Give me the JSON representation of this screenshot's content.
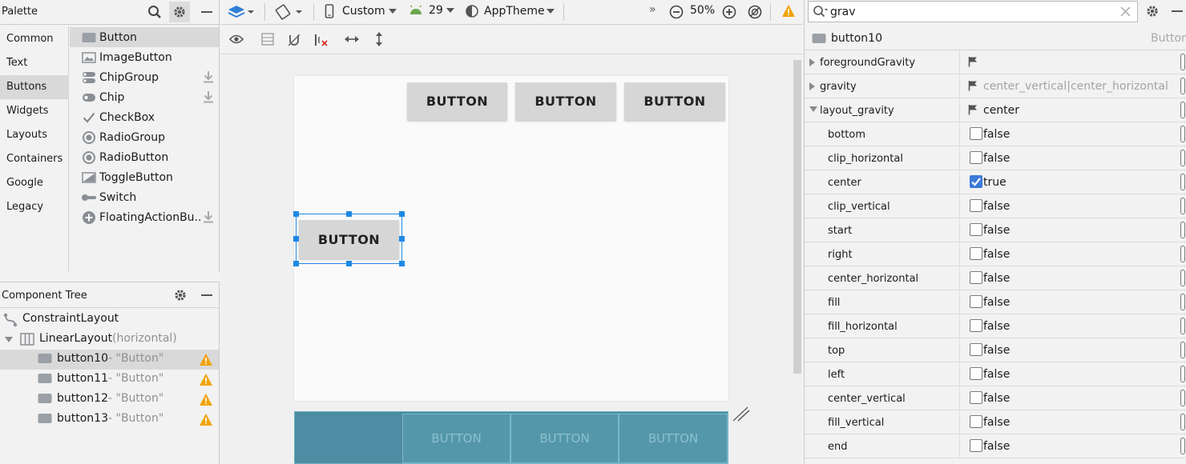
{
  "palette": {
    "title": "Palette",
    "categories": [
      "Common",
      "Text",
      "Buttons",
      "Widgets",
      "Layouts",
      "Containers",
      "Google",
      "Legacy"
    ],
    "selected_category": "Buttons",
    "widgets": [
      {
        "label": "Button",
        "icon": "button-icon",
        "download": false
      },
      {
        "label": "ImageButton",
        "icon": "image-icon",
        "download": false
      },
      {
        "label": "ChipGroup",
        "icon": "chipgroup-icon",
        "download": true
      },
      {
        "label": "Chip",
        "icon": "chip-icon",
        "download": true
      },
      {
        "label": "CheckBox",
        "icon": "checkmark-icon",
        "download": false
      },
      {
        "label": "RadioGroup",
        "icon": "radio-icon",
        "download": false
      },
      {
        "label": "RadioButton",
        "icon": "radio-icon",
        "download": false
      },
      {
        "label": "ToggleButton",
        "icon": "toggle-icon",
        "download": false
      },
      {
        "label": "Switch",
        "icon": "switch-icon",
        "download": false
      },
      {
        "label": "FloatingActionBu...",
        "icon": "fab-icon",
        "download": true
      }
    ]
  },
  "component_tree": {
    "title": "Component Tree",
    "items": [
      {
        "label": "ConstraintLayout",
        "sub": "",
        "level": 0,
        "expanded": null,
        "warn": false,
        "icon": "constraint-layout-icon"
      },
      {
        "label": "LinearLayout",
        "sub": "(horizontal)",
        "level": 0,
        "expanded": true,
        "warn": false,
        "icon": "linear-layout-icon"
      },
      {
        "label": "button10",
        "sub": "- \"Button\"",
        "level": 1,
        "warn": true,
        "selected": true,
        "icon": "button-icon"
      },
      {
        "label": "button11",
        "sub": "- \"Button\"",
        "level": 1,
        "warn": true,
        "icon": "button-icon"
      },
      {
        "label": "button12",
        "sub": "- \"Button\"",
        "level": 1,
        "warn": true,
        "icon": "button-icon"
      },
      {
        "label": "button13",
        "sub": "- \"Button\"",
        "level": 1,
        "warn": true,
        "icon": "button-icon"
      }
    ]
  },
  "toolbar": {
    "device": "Custom",
    "api": "29",
    "theme": "AppTheme",
    "zoom": "50%",
    "overflow": "»"
  },
  "canvas": {
    "buttons_top": [
      "BUTTON",
      "BUTTON",
      "BUTTON"
    ],
    "selected_button": "BUTTON",
    "blueprint_buttons": [
      "BUTTON",
      "BUTTON",
      "BUTTON"
    ],
    "accent": "#1e88e5"
  },
  "attributes": {
    "search_value": "grav",
    "component_name": "button10",
    "component_type": "Button",
    "rows": [
      {
        "name": "foregroundGravity",
        "value": "",
        "kind": "flag",
        "expander": "collapsed",
        "indent": 0
      },
      {
        "name": "gravity",
        "value": "center_vertical|center_horizontal",
        "kind": "flag",
        "expander": "collapsed",
        "indent": 0,
        "muted": true
      },
      {
        "name": "layout_gravity",
        "value": "center",
        "kind": "flag",
        "expander": "expanded",
        "indent": 0
      },
      {
        "name": "bottom",
        "value": "false",
        "kind": "check",
        "checked": false,
        "indent": 1
      },
      {
        "name": "clip_horizontal",
        "value": "false",
        "kind": "check",
        "checked": false,
        "indent": 1
      },
      {
        "name": "center",
        "value": "true",
        "kind": "check",
        "checked": true,
        "indent": 1
      },
      {
        "name": "clip_vertical",
        "value": "false",
        "kind": "check",
        "checked": false,
        "indent": 1
      },
      {
        "name": "start",
        "value": "false",
        "kind": "check",
        "checked": false,
        "indent": 1
      },
      {
        "name": "right",
        "value": "false",
        "kind": "check",
        "checked": false,
        "indent": 1
      },
      {
        "name": "center_horizontal",
        "value": "false",
        "kind": "check",
        "checked": false,
        "indent": 1
      },
      {
        "name": "fill",
        "value": "false",
        "kind": "check",
        "checked": false,
        "indent": 1
      },
      {
        "name": "fill_horizontal",
        "value": "false",
        "kind": "check",
        "checked": false,
        "indent": 1
      },
      {
        "name": "top",
        "value": "false",
        "kind": "check",
        "checked": false,
        "indent": 1
      },
      {
        "name": "left",
        "value": "false",
        "kind": "check",
        "checked": false,
        "indent": 1
      },
      {
        "name": "center_vertical",
        "value": "false",
        "kind": "check",
        "checked": false,
        "indent": 1
      },
      {
        "name": "fill_vertical",
        "value": "false",
        "kind": "check",
        "checked": false,
        "indent": 1
      },
      {
        "name": "end",
        "value": "false",
        "kind": "check",
        "checked": false,
        "indent": 1
      }
    ]
  },
  "colors": {
    "selection_blue": "#1e88e5",
    "warning": "#f0a30a",
    "blueprint": "#4d8ca2"
  }
}
